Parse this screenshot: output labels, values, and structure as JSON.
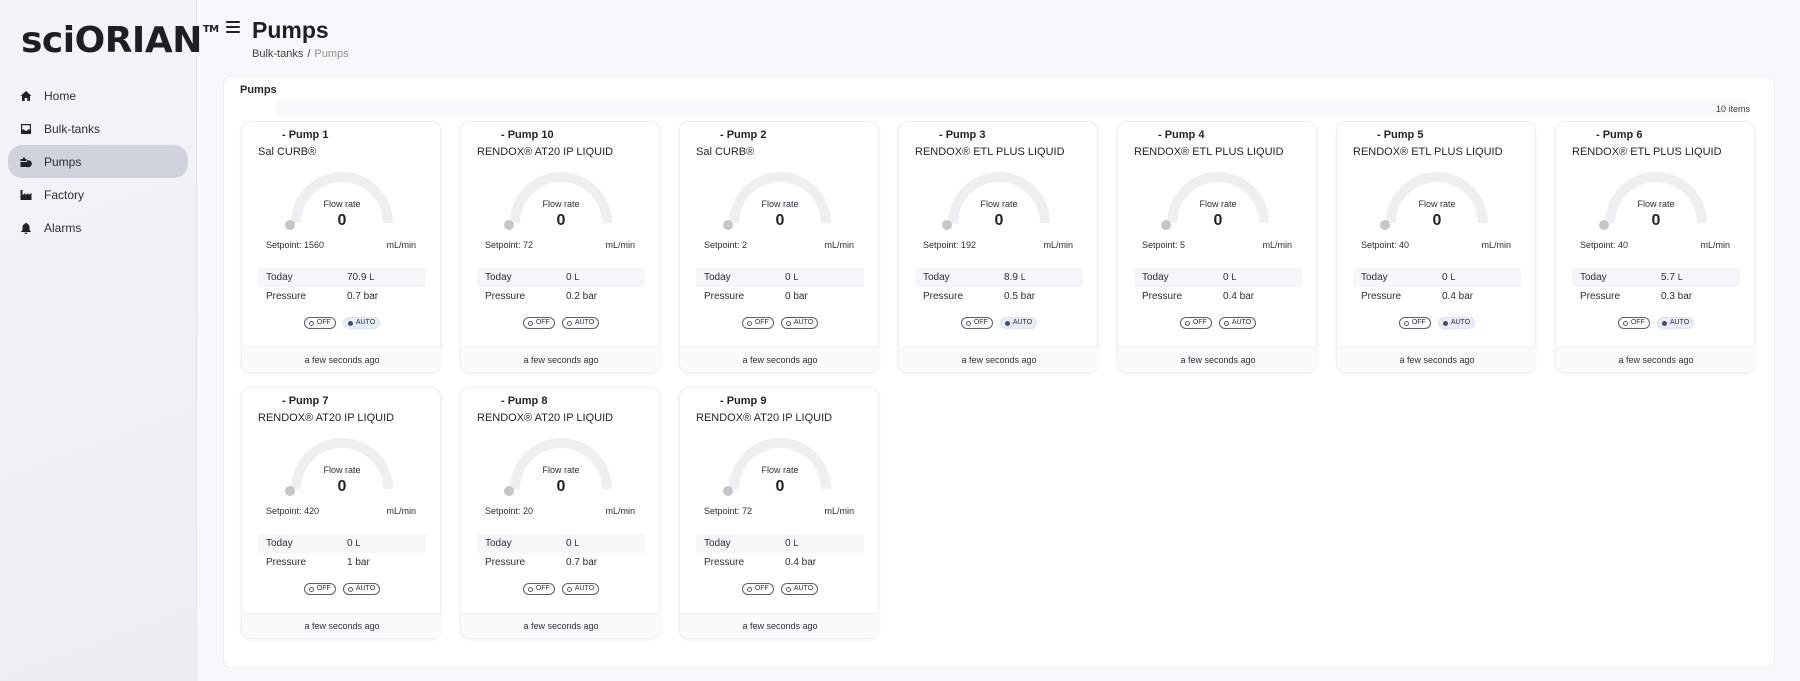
{
  "app": {
    "logo": "sciORIAN",
    "logo_tm": "TM"
  },
  "sidebar": {
    "items": [
      {
        "label": "Home",
        "icon": "home-icon",
        "active": false
      },
      {
        "label": "Bulk-tanks",
        "icon": "inbox-icon",
        "active": false
      },
      {
        "label": "Pumps",
        "icon": "pump-icon",
        "active": true
      },
      {
        "label": "Factory",
        "icon": "factory-icon",
        "active": false
      },
      {
        "label": "Alarms",
        "icon": "bell-icon",
        "active": false
      }
    ]
  },
  "header": {
    "title": "Pumps",
    "breadcrumb": {
      "parent": "Bulk-tanks",
      "separator": "/",
      "current": "Pumps"
    }
  },
  "panel": {
    "title": "Pumps",
    "count": "10 items"
  },
  "card_common": {
    "gauge_label": "Flow rate",
    "unit": "mL/min",
    "today_label": "Today",
    "pressure_label": "Pressure",
    "off_label": "OFF",
    "auto_label": "AUTO",
    "footer": "a few seconds ago"
  },
  "pumps": [
    {
      "title": "- Pump 1",
      "product": "Sal CURB®",
      "flow": "0",
      "setpoint": "Setpoint: 1560",
      "today_value": "70.9",
      "today_unit": "L",
      "pressure": "0.7 bar",
      "auto_on": true
    },
    {
      "title": "- Pump 10",
      "product": "RENDOX® AT20 IP LIQUID",
      "flow": "0",
      "setpoint": "Setpoint: 72",
      "today_value": "0",
      "today_unit": "L",
      "pressure": "0.2 bar",
      "auto_on": false
    },
    {
      "title": "- Pump 2",
      "product": "Sal CURB®",
      "flow": "0",
      "setpoint": "Setpoint: 2",
      "today_value": "0",
      "today_unit": "L",
      "pressure": "0 bar",
      "auto_on": false
    },
    {
      "title": "- Pump 3",
      "product": "RENDOX® ETL PLUS LIQUID",
      "flow": "0",
      "setpoint": "Setpoint: 192",
      "today_value": "8.9",
      "today_unit": "L",
      "pressure": "0.5 bar",
      "auto_on": true
    },
    {
      "title": "- Pump 4",
      "product": "RENDOX® ETL PLUS LIQUID",
      "flow": "0",
      "setpoint": "Setpoint: 5",
      "today_value": "0",
      "today_unit": "L",
      "pressure": "0.4 bar",
      "auto_on": false
    },
    {
      "title": "- Pump 5",
      "product": "RENDOX® ETL PLUS LIQUID",
      "flow": "0",
      "setpoint": "Setpoint: 40",
      "today_value": "0",
      "today_unit": "L",
      "pressure": "0.4 bar",
      "auto_on": true
    },
    {
      "title": "- Pump 6",
      "product": "RENDOX® ETL PLUS LIQUID",
      "flow": "0",
      "setpoint": "Setpoint: 40",
      "today_value": "5.7",
      "today_unit": "L",
      "pressure": "0.3 bar",
      "auto_on": true
    },
    {
      "title": "- Pump 7",
      "product": "RENDOX® AT20 IP LIQUID",
      "flow": "0",
      "setpoint": "Setpoint: 420",
      "today_value": "0",
      "today_unit": "L",
      "pressure": "1 bar",
      "auto_on": false
    },
    {
      "title": "- Pump 8",
      "product": "RENDOX® AT20 IP LIQUID",
      "flow": "0",
      "setpoint": "Setpoint: 20",
      "today_value": "0",
      "today_unit": "L",
      "pressure": "0.7 bar",
      "auto_on": false
    },
    {
      "title": "- Pump 9",
      "product": "RENDOX® AT20 IP LIQUID",
      "flow": "0",
      "setpoint": "Setpoint: 72",
      "today_value": "0",
      "today_unit": "L",
      "pressure": "0.4 bar",
      "auto_on": false
    }
  ],
  "colors": {
    "active_nav": "#cfd3dd",
    "gauge_track": "#eeeff1",
    "gauge_dot": "#c4c6ca",
    "auto_on_bg": "#e7edf8"
  }
}
